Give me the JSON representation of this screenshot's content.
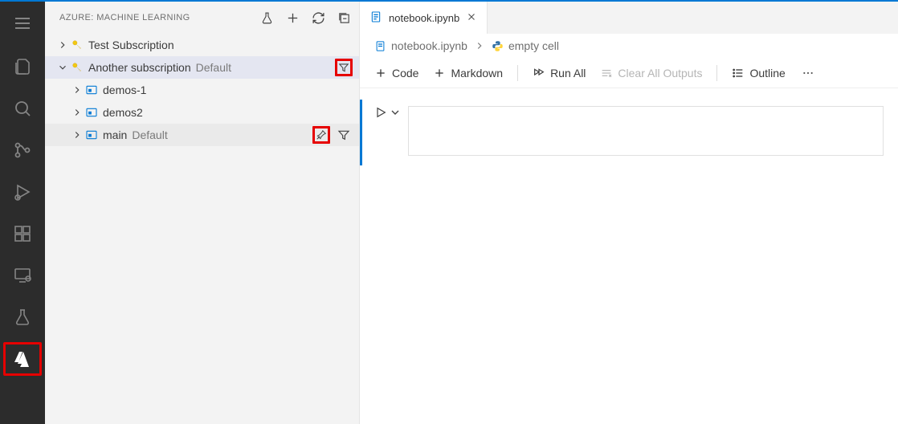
{
  "panel": {
    "title": "AZURE: MACHINE LEARNING"
  },
  "tree": {
    "subscriptions": [
      {
        "label": "Test Subscription",
        "expanded": false,
        "suffix": ""
      },
      {
        "label": "Another subscription",
        "expanded": true,
        "suffix": "Default",
        "workspaces": [
          {
            "label": "demos-1",
            "suffix": ""
          },
          {
            "label": "demos2",
            "suffix": ""
          },
          {
            "label": "main",
            "suffix": "Default"
          }
        ]
      }
    ]
  },
  "tabs": {
    "active": {
      "label": "notebook.ipynb"
    }
  },
  "breadcrumb": {
    "file": "notebook.ipynb",
    "cell": "empty cell"
  },
  "toolbar": {
    "code": "Code",
    "markdown": "Markdown",
    "runAll": "Run All",
    "clearAll": "Clear All Outputs",
    "outline": "Outline"
  }
}
